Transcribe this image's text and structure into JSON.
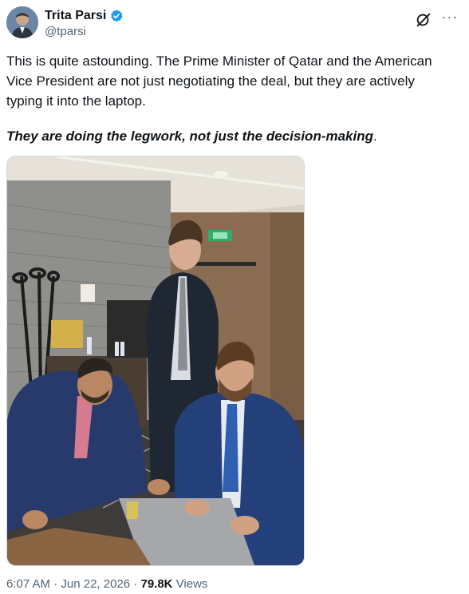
{
  "author": {
    "display_name": "Trita Parsi",
    "handle": "@tparsi",
    "verified_color": "#1d9bf0"
  },
  "tweet": {
    "text": "This is quite astounding. The Prime Minister of Qatar and the American Vice President are not just negotiating the deal, but they are actively typing it into the laptop.",
    "emphasis": "They are doing the legwork, not just the decision-making",
    "emphasis_period": "."
  },
  "photo": {
    "icons": [
      "exit-sign-icon"
    ]
  },
  "meta": {
    "time": "6:07 AM",
    "separator": "·",
    "date": "Jun 22, 2026",
    "separator2": "·",
    "views_count": "79.8K",
    "views_label": "Views"
  },
  "icons": {
    "grok": "grok-icon",
    "more": "more-icon",
    "verified": "verified-badge-icon"
  }
}
